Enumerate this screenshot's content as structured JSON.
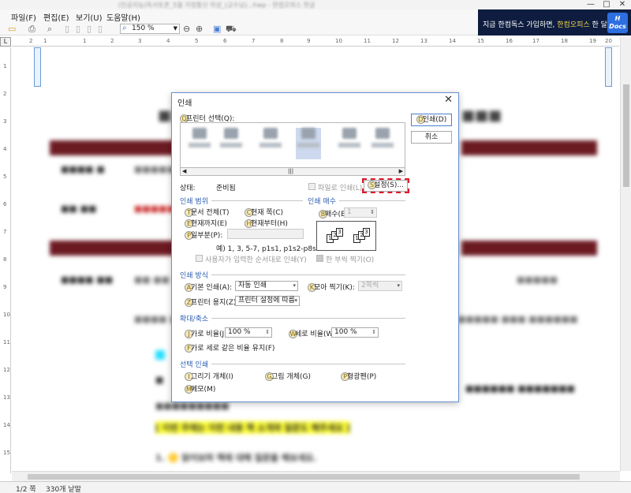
{
  "window": {
    "title": "(인공지능)독서토론_5월 가정통신 작성_(교수님)...hwp - 한컴오피스 한글",
    "controls": {
      "minimize": "—",
      "maximize": "□",
      "close": "✕"
    }
  },
  "menu": {
    "items": [
      "파일(F)",
      "편집(E)",
      "보기(U)",
      "도움말(H)"
    ]
  },
  "toolbar": {
    "zoom": "150 %"
  },
  "ad": {
    "text_pre": "지금 한컴독스 가입하면, ",
    "text_highlight": "한컴오피스",
    "text_post": " 한 달 무료!",
    "logo": "Docs"
  },
  "ruler": {
    "h_ticks": [
      "2",
      "1",
      "1",
      "2",
      "3",
      "4",
      "5",
      "6",
      "7",
      "8",
      "9",
      "10",
      "11",
      "12",
      "13",
      "14",
      "15",
      "16",
      "17",
      "18",
      "19",
      "20"
    ],
    "v_ticks": [
      "1",
      "2",
      "3",
      "4",
      "5",
      "6",
      "7",
      "8",
      "9",
      "10",
      "11",
      "12",
      "13",
      "14",
      "15"
    ]
  },
  "statusbar": {
    "page": "1/2 쪽",
    "words": "330개 낱말"
  },
  "doc": {
    "highlight_line": "[ 이번 주에는 이런 내용 책 소개와 질문도 해주세요 ]",
    "line1": "1. 🟡 읽어보며 책에 대해 질문을 해보세요."
  },
  "dialog": {
    "title": "인쇄",
    "printer_select": "프린터 선택(Q):",
    "print_button": "인쇄(D)",
    "cancel_button": "취소",
    "status_label": "상태:",
    "status_value": "준비됨",
    "print_to_file": "파일로 인쇄(L)",
    "settings_button": "설정(S)...",
    "range_section": "인쇄 범위",
    "range_all": "문서 전체(T)",
    "range_current_page": "현재 쪽(C)",
    "range_until_current": "현재까지(E)",
    "range_from_current": "현재부터(H)",
    "range_partial": "일부분(P):",
    "range_example": "예) 1, 3, 5-7, p1s1, p1s2-p8s2",
    "range_user_order": "사용자가 입력한 순서대로 인쇄(Y)",
    "copies_section": "인쇄 매수",
    "copies_label": "매수(B):",
    "copies_value": "1",
    "collate": "한 부씩 찍기(O)",
    "method_section": "인쇄 방식",
    "method_basic_label": "기본 인쇄(A):",
    "method_basic_value": "자동 인쇄",
    "method_pages_per_sheet_label": "모아 찍기(K):",
    "method_pages_per_sheet_value": "2쪽씩",
    "paper_label": "프린터 용지(Z):",
    "paper_value": "프린터 설정에 따름",
    "scale_section": "확대/축소",
    "scale_h_label": "가로 비율(J):",
    "scale_h_value": "100 %",
    "scale_v_label": "세로 비율(W):",
    "scale_v_value": "100 %",
    "scale_keep": "가로 세로 같은 비율 유지(F)",
    "select_section": "선택 인쇄",
    "select_drawing": "그리기 개체(I)",
    "select_picture": "그림 개체(G)",
    "select_highlighter": "형광펜(P)",
    "select_memo": "메모(M)",
    "printers": [
      "Adobe PDF",
      "Fax",
      "Microsoft Print to PDF",
      "Microsoft XPS",
      "OneNote",
      "Send To"
    ]
  }
}
